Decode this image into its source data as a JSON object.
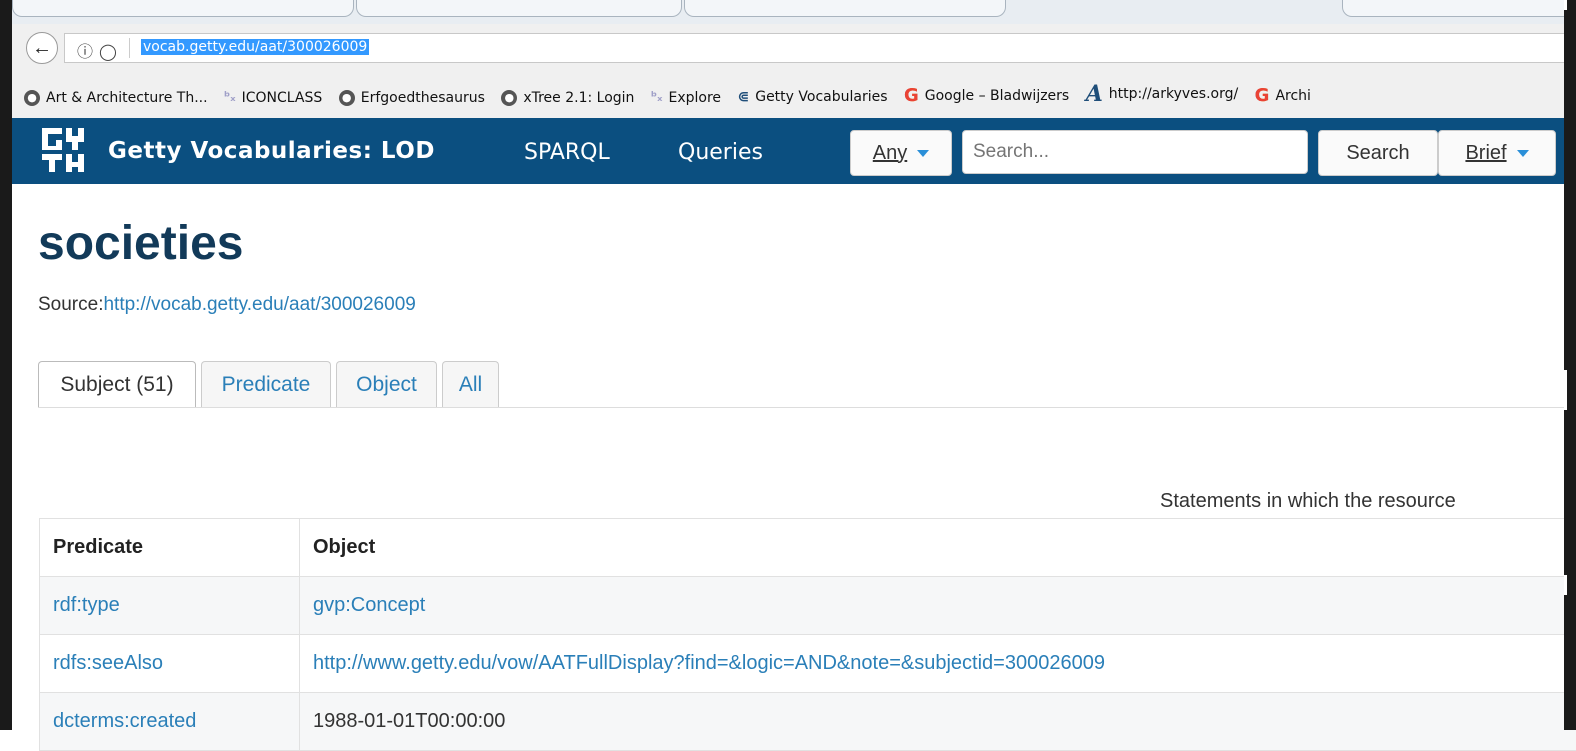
{
  "browser": {
    "url": "vocab.getty.edu/aat/300026009",
    "bookmarks": [
      {
        "label": "Art & Architecture Th...",
        "icon": "globe-icon"
      },
      {
        "label": "ICONCLASS",
        "icon": "kd-icon"
      },
      {
        "label": "Erfgoedthesaurus",
        "icon": "globe-icon"
      },
      {
        "label": "xTree 2.1: Login",
        "icon": "globe-icon"
      },
      {
        "label": "Explore",
        "icon": "kd-icon"
      },
      {
        "label": "Getty Vocabularies",
        "icon": "getty-icon"
      },
      {
        "label": "Google – Bladwijzers",
        "icon": "google-icon"
      },
      {
        "label": "http://arkyves.org/",
        "icon": "arkyves-icon"
      },
      {
        "label": "Archi",
        "icon": "google-icon"
      }
    ]
  },
  "navbar": {
    "brand": "Getty Vocabularies: LOD",
    "links": [
      "SPARQL",
      "Queries"
    ],
    "scope_label": "Any",
    "search_placeholder": "Search...",
    "search_button": "Search",
    "view_label": "Brief"
  },
  "page": {
    "title": "societies",
    "source_label": "Source:",
    "source_url": "http://vocab.getty.edu/aat/300026009",
    "tabs": [
      "Subject (51)",
      "Predicate",
      "Object",
      "All"
    ],
    "statements_caption": "Statements in which the resource"
  },
  "table": {
    "headers": [
      "Predicate",
      "Object"
    ],
    "rows": [
      {
        "predicate": "rdf:type",
        "object": "gvp:Concept"
      },
      {
        "predicate": "rdfs:seeAlso",
        "object": "http://www.getty.edu/vow/AATFullDisplay?find=&logic=AND&note=&subjectid=300026009"
      },
      {
        "predicate": "dcterms:created",
        "object": "1988-01-01T00:00:00"
      }
    ]
  },
  "colors": {
    "navbar": "#0b4f80",
    "link": "#2a7fb8",
    "title": "#123a59"
  }
}
